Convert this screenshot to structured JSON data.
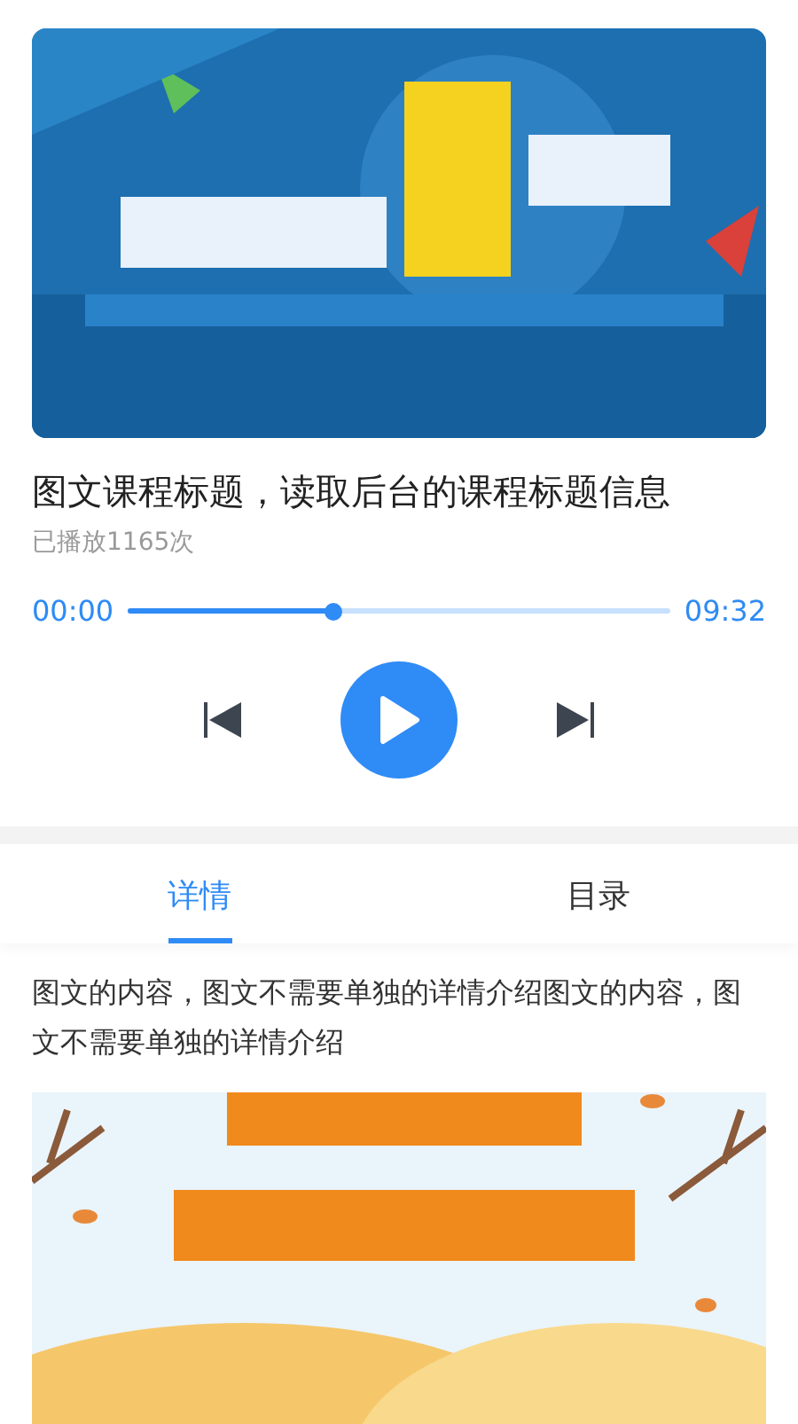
{
  "course": {
    "title": "图文课程标题，读取后台的课程标题信息",
    "plays": "已播放1165次"
  },
  "player": {
    "current": "00:00",
    "total": "09:32",
    "level": 0.38,
    "playing": false
  },
  "tabs": [
    {
      "label": "详情",
      "selected": true
    },
    {
      "label": "目录",
      "selected": false
    }
  ],
  "detail": {
    "text": "图文的内容，图文不需要单独的详情介绍图文的内容，图文不需要单独的详情介绍"
  }
}
